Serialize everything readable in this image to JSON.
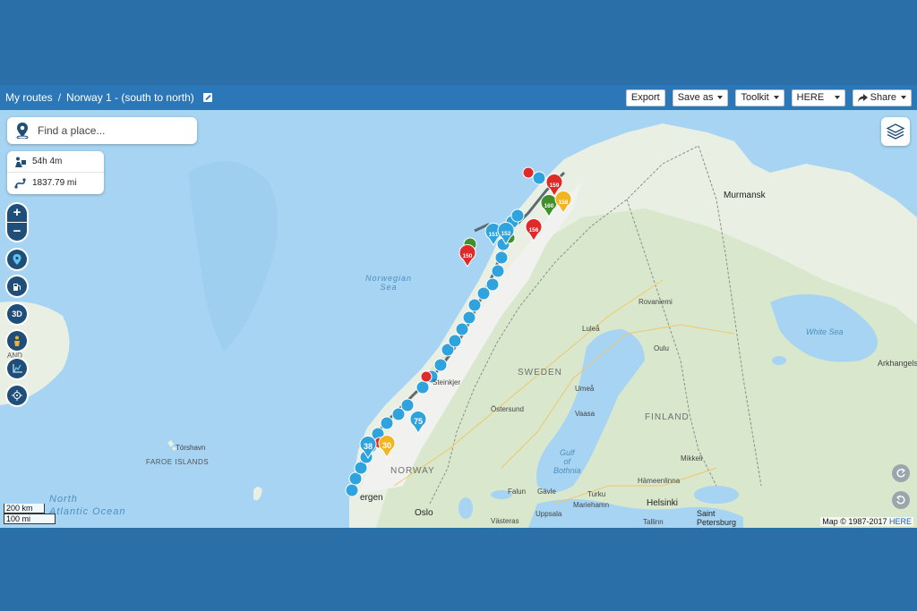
{
  "header": {
    "breadcrumb_root": "My routes",
    "separator": "/",
    "route_name": "Norway 1 - (south to north)"
  },
  "toolbar": {
    "export_label": "Export",
    "save_as_label": "Save as",
    "toolkit_label": "Toolkit",
    "map_provider_value": "HERE",
    "share_label": "Share"
  },
  "search": {
    "placeholder": "Find a place..."
  },
  "route_stats": {
    "duration": "54h 4m",
    "distance": "1837.79 mi"
  },
  "controls": {
    "zoom_in": "+",
    "zoom_out": "−",
    "three_d": "3D"
  },
  "scale": {
    "metric": "200 km",
    "imperial": "100 mi"
  },
  "attribution": {
    "text": "Map © 1987-2017",
    "link": "HERE"
  },
  "map_labels": {
    "norwegian_sea": "Norwegian\nSea",
    "north_atlantic": "North\nAtlantic Ocean",
    "white_sea": "White Sea",
    "gulf_of_bothnia": "Gulf\nof\nBothnia",
    "sweden": "SWEDEN",
    "finland": "FINLAND",
    "norway": "NORWAY",
    "faroe_islands": "FAROE ISLANDS",
    "torshavn": "Tórshavn",
    "murmansk": "Murmansk",
    "arkhangelsk": "Arkhangels",
    "rovaniemi": "Rovaniemi",
    "oulu": "Oulu",
    "lulea": "Luleå",
    "umea": "Umeå",
    "vaasa": "Vaasa",
    "ostersund": "Östersund",
    "steinkjer": "Steinkjer",
    "mikkeli": "Mikkeli",
    "hameenlinna": "Hämeenlinna",
    "helsinki": "Helsinki",
    "tallinn": "Tallinn",
    "saint_petersburg": "Saint\nPetersburg",
    "bergen": "ergen",
    "oslo": "Oslo",
    "falun": "Falun",
    "gavle": "Gävle",
    "uppsala": "Uppsala",
    "vasteras": "Västeras",
    "turku": "Turku",
    "mariehamn": "Mariehamn",
    "iceland_fragment": "AND"
  },
  "markers": [
    {
      "label": "159",
      "color": "#e02a2a"
    },
    {
      "label": "160",
      "color": "#3f8f2a"
    },
    {
      "label": "158",
      "color": "#f2b51f"
    },
    {
      "label": "156",
      "color": "#e02a2a"
    },
    {
      "label": "151",
      "color": "#2ea3dd"
    },
    {
      "label": "152",
      "color": "#2ea3dd"
    },
    {
      "label": "150",
      "color": "#e02a2a"
    },
    {
      "label": "75",
      "color": "#2ea3dd"
    },
    {
      "label": "38",
      "color": "#2ea3dd"
    },
    {
      "label": "30",
      "color": "#f2b51f"
    }
  ],
  "colors": {
    "water": "#a6d4f2",
    "land": "#e9efe2",
    "forest": "#cfe4c2",
    "topbar": "#2c77b8",
    "control_dark": "#1f4e79",
    "route_line": "#5d6a72"
  }
}
